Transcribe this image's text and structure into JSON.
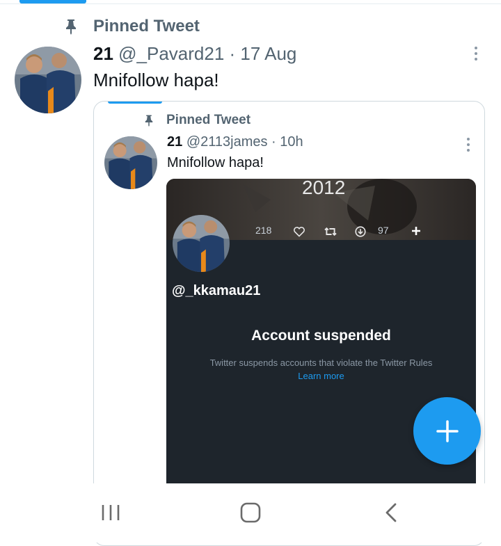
{
  "tweet": {
    "pinned_label": "Pinned Tweet",
    "name": "21",
    "handle_meta": "@_Pavard21 · 17 Aug",
    "text": "Mnifollow hapa!"
  },
  "quoted": {
    "pinned_label": "Pinned Tweet",
    "name": "21",
    "handle_meta": "@2113james · 10h",
    "text": "Mnifollow hapa!",
    "media": {
      "year_text": "2012",
      "likes": "218",
      "downloads": "97",
      "profile_handle": "@_kkamau21",
      "suspended_title": "Account suspended",
      "suspended_desc": "Twitter suspends accounts that violate the Twitter Rules",
      "learn_more": "Learn more"
    }
  },
  "colors": {
    "accent": "#1d9bf0",
    "secondary_text": "#536471",
    "media_bg": "#1e252c"
  },
  "icons": [
    "pin-icon",
    "more-icon",
    "heart-icon",
    "retweet-icon",
    "download-icon",
    "plus-icon",
    "compose-icon",
    "recent-apps-icon",
    "home-icon",
    "back-icon"
  ]
}
